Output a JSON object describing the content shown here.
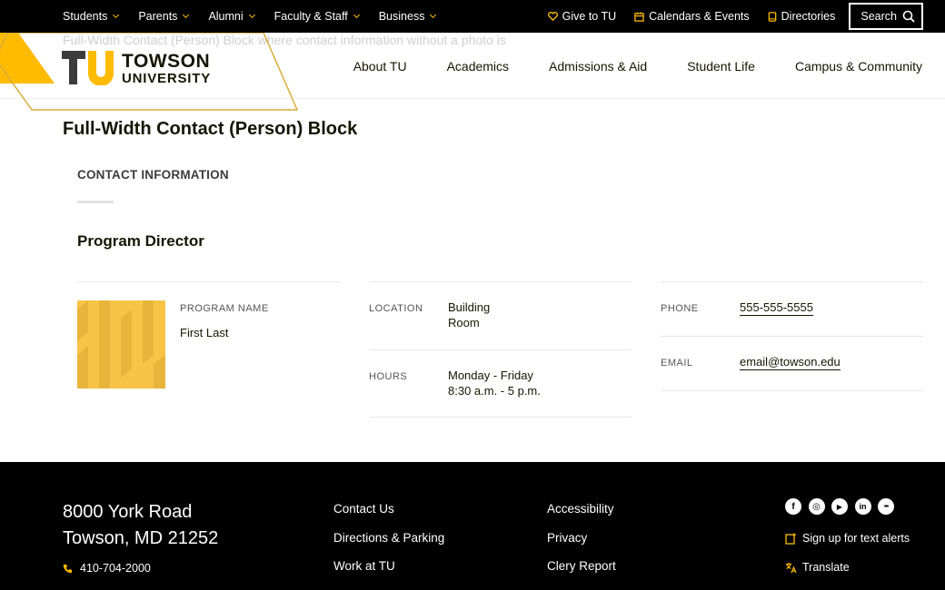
{
  "utility": {
    "left_links": [
      {
        "label": "Students"
      },
      {
        "label": "Parents"
      },
      {
        "label": "Alumni"
      },
      {
        "label": "Faculty & Staff"
      },
      {
        "label": "Business"
      }
    ],
    "give_label": "Give to TU",
    "calendars_label": "Calendars & Events",
    "directories_label": "Directories",
    "search_label": "Search"
  },
  "header": {
    "ghost_text": "Full-Width Contact (Person) Block where contact information without a photo is",
    "logo_mark": "TU",
    "logo_line1": "TOWSON",
    "logo_line2": "UNIVERSITY",
    "nav": [
      {
        "label": "About TU"
      },
      {
        "label": "Academics"
      },
      {
        "label": "Admissions & Aid"
      },
      {
        "label": "Student Life"
      },
      {
        "label": "Campus & Community"
      }
    ]
  },
  "main": {
    "page_title": "Full-Width Contact (Person) Block",
    "section_title": "CONTACT INFORMATION",
    "person_title": "Program Director",
    "program_label": "PROGRAM NAME",
    "person_name": "First Last",
    "location_label": "LOCATION",
    "location_line1": "Building",
    "location_line2": "Room",
    "hours_label": "HOURS",
    "hours_line1": "Monday - Friday",
    "hours_line2": "8:30 a.m. - 5 p.m.",
    "phone_label": "PHONE",
    "phone_value": "555-555-5555",
    "email_label": "EMAIL",
    "email_value": "email@towson.edu"
  },
  "footer": {
    "address_line1": "8000 York Road",
    "address_line2": "Towson, MD 21252",
    "phone": "410-704-2000",
    "col1": [
      {
        "label": "Contact Us"
      },
      {
        "label": "Directions & Parking"
      },
      {
        "label": "Work at TU"
      }
    ],
    "col2": [
      {
        "label": "Accessibility"
      },
      {
        "label": "Privacy"
      },
      {
        "label": "Clery Report"
      }
    ],
    "social": [
      {
        "icon": "facebook-icon",
        "glyph": "f"
      },
      {
        "icon": "instagram-icon",
        "glyph": "◎"
      },
      {
        "icon": "youtube-icon",
        "glyph": "▶"
      },
      {
        "icon": "linkedin-icon",
        "glyph": "in"
      },
      {
        "icon": "more-icon",
        "glyph": "•••"
      }
    ],
    "text_alerts": "Sign up for text alerts",
    "translate": "Translate"
  },
  "colors": {
    "gold": "#ffbb00",
    "black": "#000000",
    "text": "#151500"
  }
}
